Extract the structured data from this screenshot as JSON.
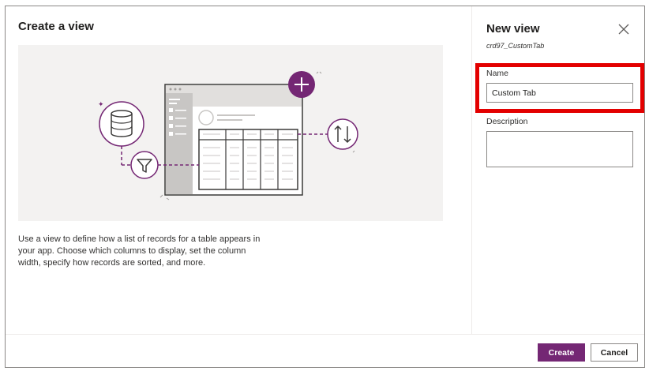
{
  "left": {
    "title": "Create a view",
    "description": "Use a view to define how a list of records for a table appears in your app. Choose which columns to display, set the column width, specify how records are sorted, and more."
  },
  "panel": {
    "title": "New view",
    "subtitle": "crd97_CustomTab",
    "name_label": "Name",
    "name_value": "Custom Tab",
    "description_label": "Description",
    "description_value": ""
  },
  "footer": {
    "create_label": "Create",
    "cancel_label": "Cancel"
  },
  "colors": {
    "accent": "#742774",
    "highlight": "#e30000",
    "illustration_bg": "#f3f2f1"
  },
  "icons": [
    "close-icon",
    "database-icon",
    "filter-icon",
    "sort-icon",
    "add-icon"
  ]
}
